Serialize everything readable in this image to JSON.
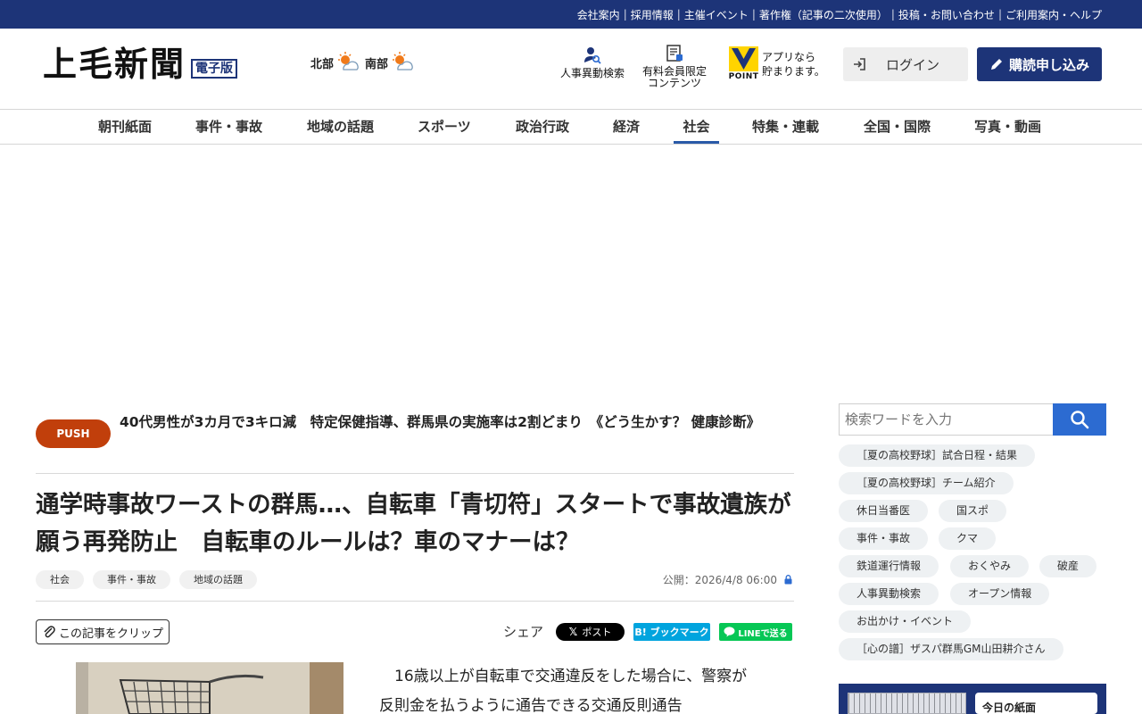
{
  "topbar": {
    "links": [
      "会社案内",
      "採用情報",
      "主催イベント",
      "著作権（記事の二次使用）",
      "投稿・お問い合わせ",
      "ご利用案内・ヘルプ"
    ]
  },
  "header": {
    "logo_text": "上毛新聞",
    "logo_badge": "電子版",
    "weather": [
      {
        "region": "北部",
        "icon": "sun-cloud-icon"
      },
      {
        "region": "南部",
        "icon": "sun-cloud-icon"
      }
    ],
    "jinji_label": "人事異動検索",
    "yuryo_line1": "有料会員限定",
    "yuryo_line2": "コンテンツ",
    "vpoint_badge": "POINT",
    "vpoint_line1": "アプリなら",
    "vpoint_line2": "貯まります。",
    "login_label": "ログイン",
    "subscribe_label": "購読申し込み",
    "colors": {
      "navy": "#1d3478",
      "accent_blue": "#2c6bd1",
      "push_red": "#c13f0b"
    }
  },
  "nav": {
    "items": [
      "朝刊紙面",
      "事件・事故",
      "地域の話題",
      "スポーツ",
      "政治行政",
      "経済",
      "社会",
      "特集・連載",
      "全国・国際",
      "写真・動画"
    ],
    "active": "社会"
  },
  "push": {
    "badge": "PUSH",
    "text": "40代男性が3カ月で3キロ減　特定保健指導、群馬県の実施率は2割どまり　《どう生かす？ 健康診断》"
  },
  "article": {
    "title": "通学時事故ワーストの群馬…、自転車「青切符」スタートで事故遺族が願う再発防止　自転車のルールは？車のマナーは？",
    "tags": [
      "社会",
      "事件・事故",
      "地域の話題"
    ],
    "published": "公開：2026/4/8 06:00",
    "clip_label": "この記事をクリップ",
    "share_label": "シェア",
    "share_x": "ポスト",
    "share_x_logo": "𝕏",
    "share_hatena": "B! ブックマーク",
    "share_line": "LINEで送る",
    "body": "16歳以上が自転車で交通違反をした場合に、警察が反則金を払うように通告できる交通反則通告"
  },
  "sidebar": {
    "search_placeholder": "検索ワードを入力",
    "chips": [
      "［夏の高校野球］試合日程・結果",
      "［夏の高校野球］チーム紹介",
      "休日当番医",
      "国スポ",
      "事件・事故",
      "クマ",
      "鉄道運行情報",
      "おくやみ",
      "破産",
      "人事異動検索",
      "オープン情報",
      "お出かけ・イベント",
      "［心の譜］ザスパ群馬GM山田耕介さん"
    ],
    "paper_card": "今日の紙面"
  }
}
